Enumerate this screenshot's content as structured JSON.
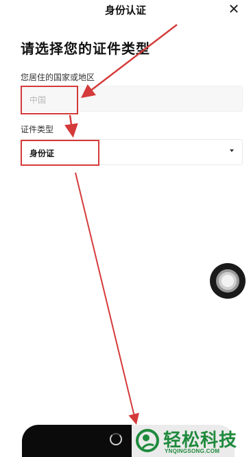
{
  "header": {
    "title": "身份认证",
    "close_icon": "close-icon"
  },
  "form": {
    "title": "请选择您的证件类型",
    "country_label": "您居住的国家或地区",
    "country_value": "中国",
    "id_type_label": "证件类型",
    "id_type_value": "身份证"
  },
  "annotation": {
    "color": "#d43a3a"
  },
  "watermark": {
    "brand": "轻松科技",
    "domain": "YNQINGSONG.COM",
    "color": "#1e8a3c"
  }
}
